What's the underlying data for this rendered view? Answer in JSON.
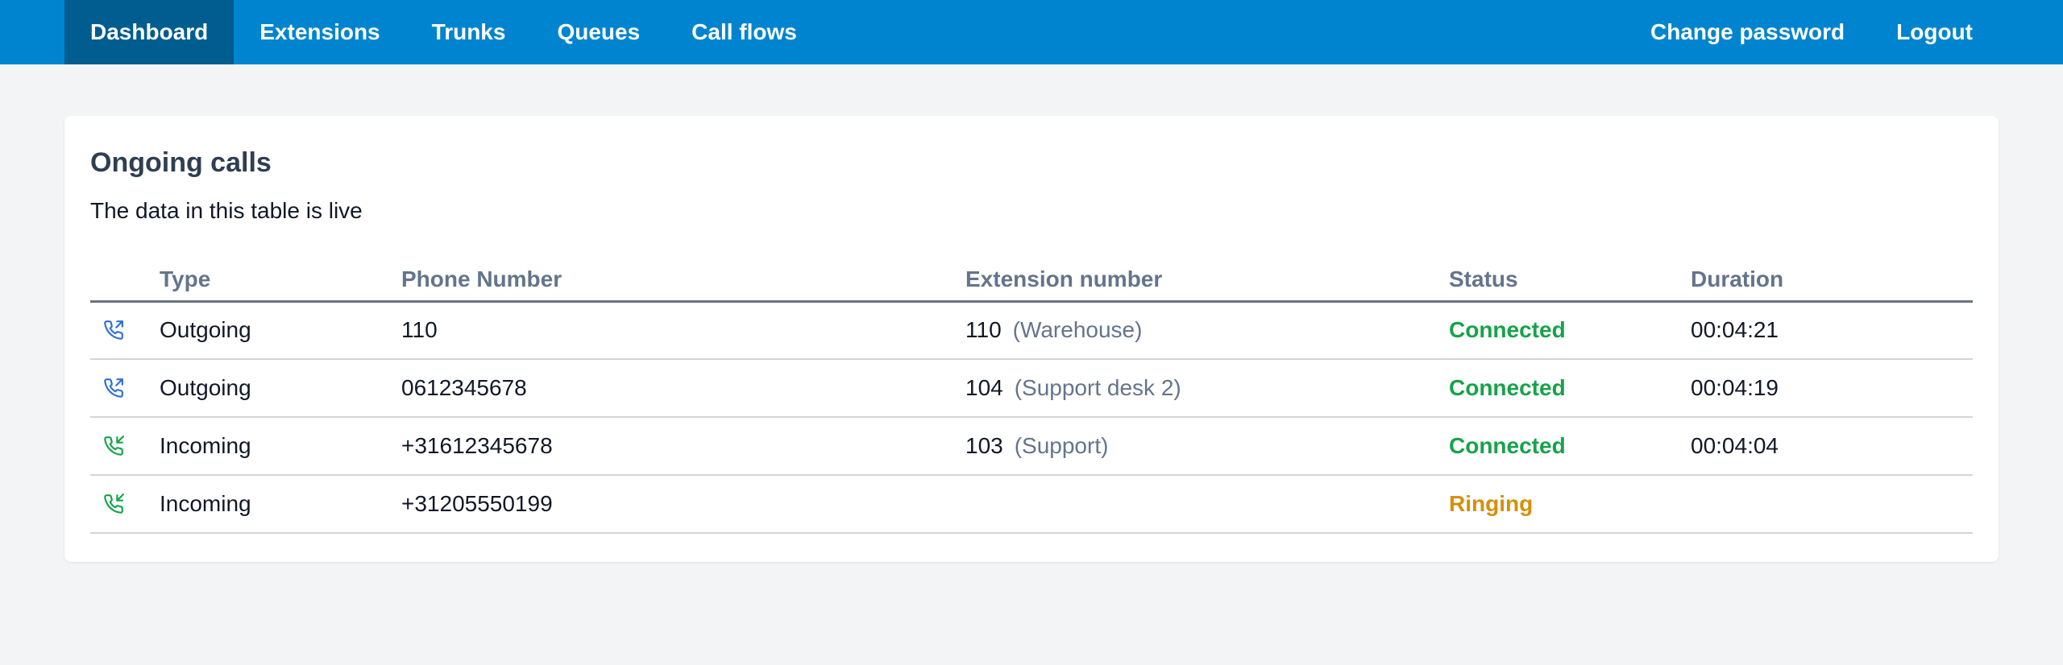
{
  "nav": {
    "left": [
      {
        "label": "Dashboard",
        "active": true
      },
      {
        "label": "Extensions"
      },
      {
        "label": "Trunks"
      },
      {
        "label": "Queues"
      },
      {
        "label": "Call flows"
      }
    ],
    "right": [
      {
        "label": "Change password"
      },
      {
        "label": "Logout"
      }
    ]
  },
  "card": {
    "title": "Ongoing calls",
    "subtitle": "The data in this table is live"
  },
  "table": {
    "headers": [
      "Type",
      "Phone Number",
      "Extension number",
      "Status",
      "Duration"
    ],
    "rows": [
      {
        "icon": "outgoing-call-icon",
        "type": "Outgoing",
        "phone": "110",
        "ext_number": "110",
        "ext_name": "(Warehouse)",
        "status": "Connected",
        "duration": "00:04:21"
      },
      {
        "icon": "outgoing-call-icon",
        "type": "Outgoing",
        "phone": "0612345678",
        "ext_number": "104",
        "ext_name": "(Support desk 2)",
        "status": "Connected",
        "duration": "00:04:19"
      },
      {
        "icon": "incoming-call-icon",
        "type": "Incoming",
        "phone": "+31612345678",
        "ext_number": "103",
        "ext_name": "(Support)",
        "status": "Connected",
        "duration": "00:04:04"
      },
      {
        "icon": "incoming-call-icon",
        "type": "Incoming",
        "phone": "+31205550199",
        "ext_number": "",
        "ext_name": "",
        "status": "Ringing",
        "duration": ""
      }
    ]
  },
  "colors": {
    "nav_bg": "#0184cf",
    "nav_active_bg": "#015c8f",
    "outgoing_icon": "#2f6fd6",
    "incoming_icon": "#16a34a",
    "status_connected": "#16a34a",
    "status_ringing": "#d4900a"
  }
}
